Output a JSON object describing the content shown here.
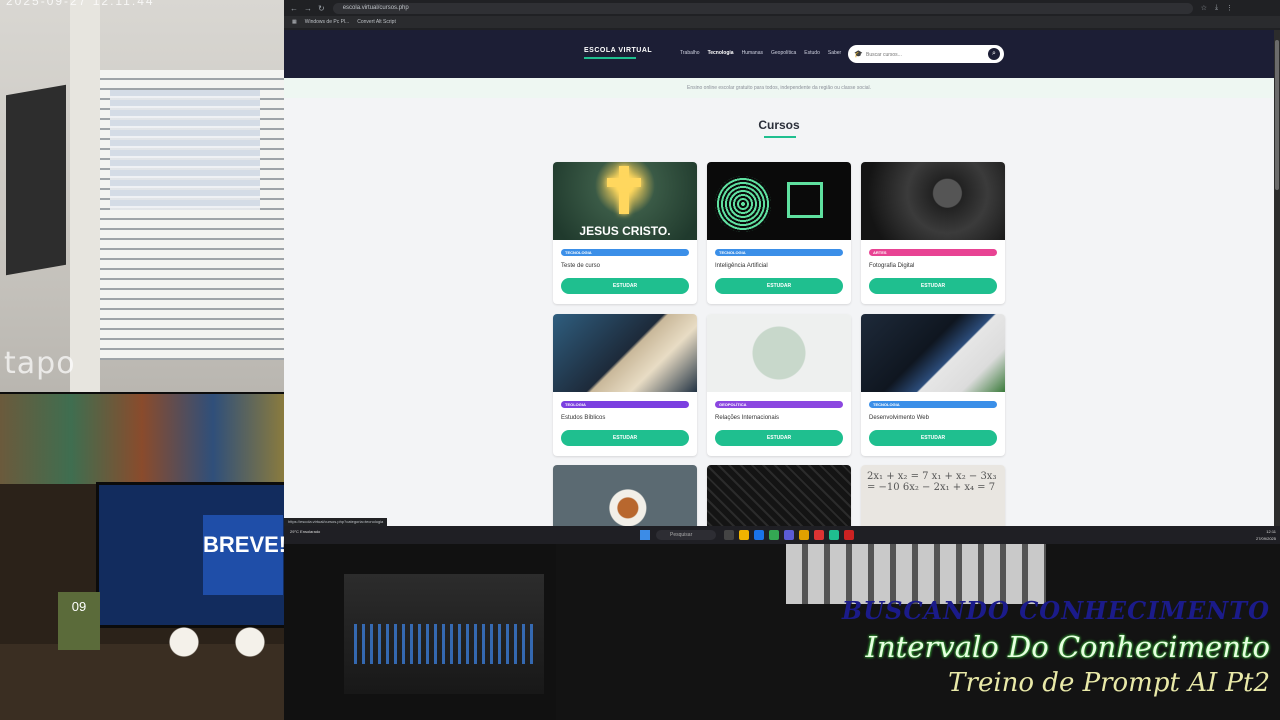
{
  "camera1": {
    "timestamp": "2025-09-27 12:11:44",
    "watermark": "tapo"
  },
  "camera2": {
    "monitor_text": "BREVE!",
    "calendar_day": "09"
  },
  "overlay": {
    "line1": "BUSCANDO CONHECIMENTO",
    "line2": "Intervalo Do Conhecimento",
    "line3": "Treino de Prompt AI Pt2"
  },
  "browser": {
    "url": "escola.virtual/cursos.php",
    "bookmarks": [
      "Windows de Pc Pl...",
      "Convert Alt Script"
    ],
    "status_url": "https://escola.virtual/cursos.php?categoria=tecnologia"
  },
  "site": {
    "logo": "ESCOLA VIRTUAL",
    "menu": [
      "Trabalho",
      "Tecnologia",
      "Humanas",
      "Geopolítica",
      "Estudo",
      "Saber"
    ],
    "active_menu": "Tecnologia",
    "search_placeholder": "Buscar cursos...",
    "tagline": "Ensino online escolar gratuito para todos, independente da região ou classe social.",
    "section_title": "Cursos",
    "button_label": "ESTUDAR"
  },
  "courses": [
    {
      "name": "Teste de curso",
      "tag": "TECNOLOGIA",
      "tag_color": "#3b8fe8",
      "image_text": "JESUS CRISTO."
    },
    {
      "name": "Inteligência Artificial",
      "tag": "TECNOLOGIA",
      "tag_color": "#3b8fe8",
      "image_text": ""
    },
    {
      "name": "Fotografia Digital",
      "tag": "ARTES",
      "tag_color": "#e84393",
      "image_text": ""
    },
    {
      "name": "Estudos Bíblicos",
      "tag": "TEOLOGIA",
      "tag_color": "#7b3fe0",
      "image_text": ""
    },
    {
      "name": "Relações Internacionais",
      "tag": "GEOPOLÍTICA",
      "tag_color": "#8b47e0",
      "image_text": ""
    },
    {
      "name": "Desenvolvimento Web",
      "tag": "TECNOLOGIA",
      "tag_color": "#3b8fe8",
      "image_text": ""
    },
    {
      "name": "",
      "tag": "",
      "tag_color": "",
      "image_text": ""
    },
    {
      "name": "",
      "tag": "",
      "tag_color": "",
      "image_text": ""
    },
    {
      "name": "",
      "tag": "",
      "tag_color": "",
      "image_text": "2x₁ + x₂ = 7   x₁ + x₂ − 3x₃ = −10   6x₂ − 2x₁ + x₄ = 7"
    }
  ],
  "taskbar": {
    "search_label": "Pesquisar",
    "weather": "29°C Ensolarado",
    "time": "12:11",
    "date": "27/09/2025"
  },
  "colors": {
    "header_bg": "#1c1e35",
    "accent": "#1fbf8f",
    "page_bg": "#f3f4f6"
  }
}
